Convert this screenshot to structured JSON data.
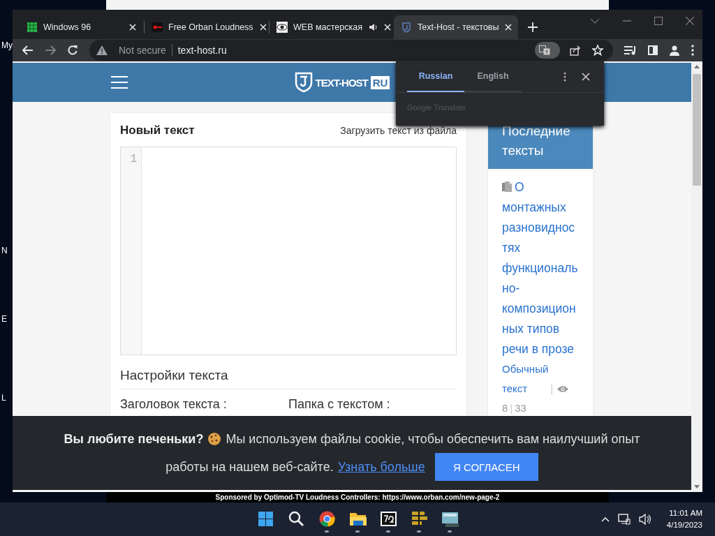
{
  "desktop": {
    "icon_labels": [
      "My",
      "N",
      "E",
      "L"
    ]
  },
  "background_window": {
    "banner": "Sponsored by Optimod-TV Loudness Controllers: https://www.orban.com/new-page-2"
  },
  "browser": {
    "tabs": [
      {
        "kind": "grid",
        "title": "Windows 96",
        "selected": false,
        "audio": false
      },
      {
        "kind": "key",
        "title": "Free Orban Loudness",
        "selected": false,
        "audio": false
      },
      {
        "kind": "eye",
        "title": "WEB мастерская",
        "selected": false,
        "audio": true
      },
      {
        "kind": "shield",
        "title": "Text-Host - текстовы",
        "selected": true,
        "audio": false
      }
    ],
    "address": {
      "security": "Not secure",
      "url": "text-host.ru"
    }
  },
  "translate_popup": {
    "languages": [
      {
        "label": "Russian",
        "selected": true
      },
      {
        "label": "English",
        "selected": false
      }
    ],
    "footer": "Google Translate"
  },
  "site": {
    "logo": {
      "text": "TEXT-HOST",
      "badge": "RU"
    },
    "editor": {
      "title": "Новый текст",
      "upload_link": "Загрузить текст из файла",
      "line_numbers": [
        "1"
      ]
    },
    "settings": {
      "title": "Настройки текста",
      "fields": [
        "Заголовок текста :",
        "Папка с текстом :"
      ]
    },
    "sidebar": {
      "title": "Последние тексты",
      "items": [
        {
          "title": "О монтажных разновидностях функционально-композиционных типов речи в прозе",
          "type": "Обычный текст",
          "separator": "|",
          "views": "8",
          "count": "33"
        }
      ]
    }
  },
  "cookie_banner": {
    "heading": "Вы любите печеньки?",
    "message": [
      "Мы используем файлы cookie, чтобы обеспечить вам наилучший опыт",
      "работы на нашем веб-сайте."
    ],
    "link": "Узнать больше",
    "button": "Я СОГЛАСЕН"
  },
  "taskbar": {
    "apps": [
      {
        "kind": "start",
        "running": false
      },
      {
        "kind": "search",
        "running": false
      },
      {
        "kind": "chrome",
        "running": true
      },
      {
        "kind": "folder",
        "running": true
      },
      {
        "kind": "archiver",
        "running": true
      },
      {
        "kind": "bars",
        "running": true
      },
      {
        "kind": "monitor",
        "running": true
      }
    ],
    "time": "11:01 AM",
    "date": "4/19/2023"
  }
}
